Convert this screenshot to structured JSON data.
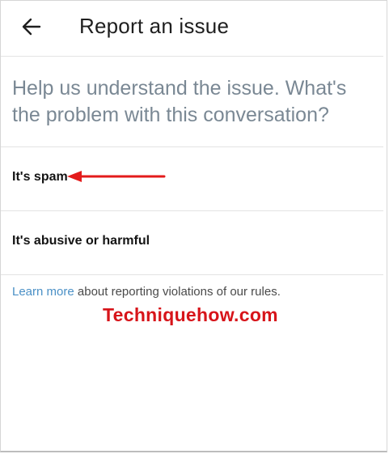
{
  "header": {
    "back_icon": "arrow-left-icon",
    "title": "Report an issue"
  },
  "prompt": "Help us understand the issue. What's the problem with this conversation?",
  "options": [
    {
      "label": "It's spam"
    },
    {
      "label": "It's abusive or harmful"
    }
  ],
  "annotation": {
    "icon": "red-arrow-icon",
    "color": "#e31b1b"
  },
  "footer": {
    "link_text": "Learn more",
    "text": " about reporting violations of our rules.",
    "link_color": "#4a90c6"
  },
  "watermark": "Techniquehow.com"
}
